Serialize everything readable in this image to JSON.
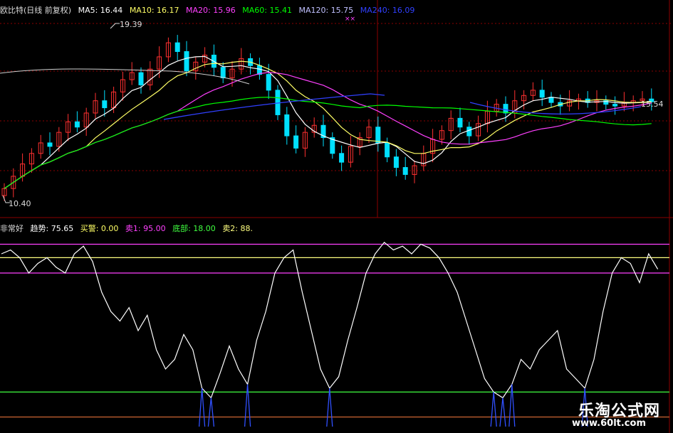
{
  "header_main": {
    "title": "欧比特(日线 前复权)",
    "ma5": "MA5: 16.44",
    "ma10": "MA10: 16.17",
    "ma20": "MA20: 15.96",
    "ma60": "MA60: 15.41",
    "ma120": "MA120: 15.75",
    "ma240": "MA240: 16.09",
    "marker": "××"
  },
  "header_indicator": {
    "name": "非常好",
    "trend": "趋势: 75.65",
    "buy_alert": "买警: 0.00",
    "sell1": "卖1: 95.00",
    "bottom": "底部: 18.00",
    "sell2": "卖2: 88."
  },
  "price_labels": {
    "high": "19.39",
    "low": "10.40",
    "right": "15.54"
  },
  "watermark": {
    "cn": "乐淘公式网",
    "url": "www.60lt.com"
  },
  "colors": {
    "up": "#ff3030",
    "down": "#00e0ff",
    "ma5": "#ffffff",
    "ma10": "#ffff66",
    "ma20": "#ff40ff",
    "ma60": "#00ff00",
    "ma120": "#8080ff",
    "ma240": "#3040ff",
    "trend": "#ffffff",
    "sell1": "#ff40ff",
    "sell2": "#ffff80",
    "bottom": "#40ff40",
    "grid": "#8b0000"
  },
  "chart_data": [
    {
      "type": "candlestick",
      "title": "欧比特(日线 前复权)",
      "series": [
        {
          "name": "MA5",
          "last": 16.44
        },
        {
          "name": "MA10",
          "last": 16.17
        },
        {
          "name": "MA20",
          "last": 15.96
        },
        {
          "name": "MA60",
          "last": 15.41
        },
        {
          "name": "MA120",
          "last": 15.75
        },
        {
          "name": "MA240",
          "last": 16.09
        }
      ],
      "annotations": {
        "high": 19.39,
        "low": 10.4,
        "last": 15.54
      },
      "close": [
        10.6,
        11.3,
        12.0,
        12.6,
        13.2,
        13.0,
        13.8,
        14.4,
        14.1,
        14.9,
        15.6,
        15.2,
        16.1,
        16.8,
        17.2,
        16.5,
        17.4,
        18.1,
        18.9,
        18.4,
        17.3,
        17.8,
        18.2,
        17.5,
        16.9,
        17.4,
        18.0,
        17.6,
        17.1,
        16.2,
        14.8,
        13.6,
        12.9,
        13.8,
        14.2,
        13.5,
        12.6,
        12.1,
        13.0,
        13.5,
        14.1,
        13.2,
        12.4,
        11.8,
        11.4,
        11.9,
        12.6,
        13.4,
        13.9,
        14.6,
        14.1,
        13.6,
        14.3,
        15.0,
        15.4,
        14.9,
        15.6,
        15.9,
        16.2,
        15.8,
        15.5,
        15.3,
        15.6,
        15.7,
        15.5,
        15.6,
        15.4,
        15.3,
        15.5,
        15.6,
        15.7,
        15.54
      ]
    },
    {
      "type": "line",
      "title": "非常好",
      "series": [
        {
          "name": "趋势",
          "last": 75.65
        },
        {
          "name": "买警",
          "last": 0.0
        },
        {
          "name": "卖1",
          "last": 95.0
        },
        {
          "name": "底部",
          "last": 18.0
        },
        {
          "name": "卖2",
          "last": 88
        }
      ],
      "trend": [
        90,
        92,
        88,
        80,
        85,
        88,
        83,
        80,
        90,
        94,
        86,
        70,
        60,
        55,
        62,
        50,
        58,
        40,
        30,
        35,
        48,
        40,
        20,
        15,
        28,
        42,
        30,
        22,
        45,
        60,
        80,
        88,
        92,
        70,
        50,
        30,
        20,
        26,
        45,
        62,
        80,
        90,
        96,
        92,
        94,
        90,
        95,
        93,
        88,
        80,
        70,
        55,
        40,
        25,
        18,
        15,
        22,
        35,
        30,
        40,
        45,
        50,
        30,
        25,
        20,
        35,
        60,
        80,
        88,
        85,
        75,
        90,
        82
      ],
      "ylim": [
        0,
        100
      ]
    }
  ]
}
